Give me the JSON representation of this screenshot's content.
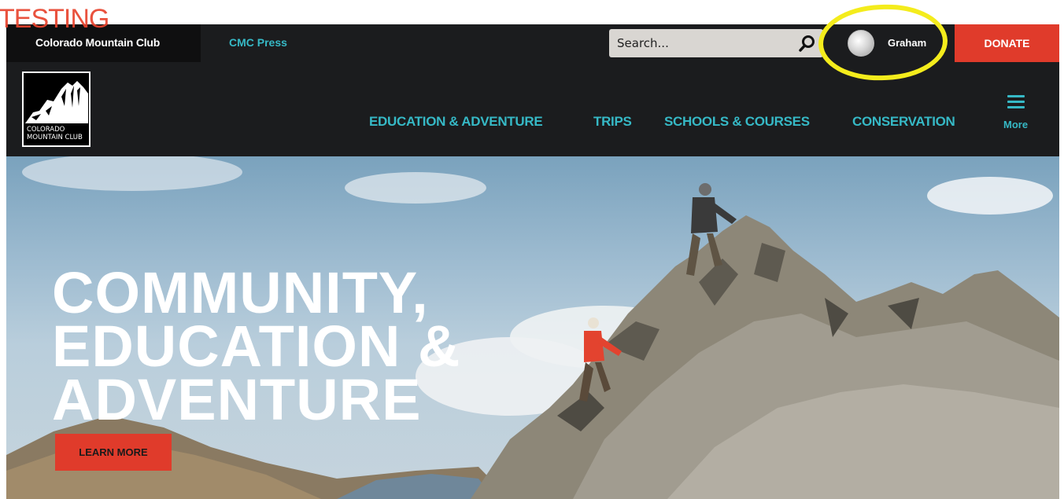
{
  "topbar": {
    "club_link": "Colorado Mountain Club",
    "press_link": "CMC Press",
    "search": {
      "placeholder": "Search..."
    },
    "user_name": "Graham",
    "donate_label": "DONATE",
    "overlay_label": "TESTING"
  },
  "logo": {
    "line1": "COLORADO",
    "line2": "MOUNTAIN CLUB"
  },
  "nav": {
    "items": [
      {
        "label": "EDUCATION & ADVENTURE"
      },
      {
        "label": "TRIPS"
      },
      {
        "label": "SCHOOLS & COURSES"
      },
      {
        "label": "CONSERVATION"
      }
    ],
    "more_label": "More"
  },
  "hero": {
    "line1": "COMMUNITY,",
    "line2": "EDUCATION &",
    "line3": "ADVENTURE",
    "cta_label": "LEARN MORE"
  },
  "colors": {
    "nav_bg": "#1b1c1e",
    "accent_teal": "#36b9c6",
    "donate_red": "#e03b2b",
    "highlight_yellow": "#f4ec1c"
  }
}
